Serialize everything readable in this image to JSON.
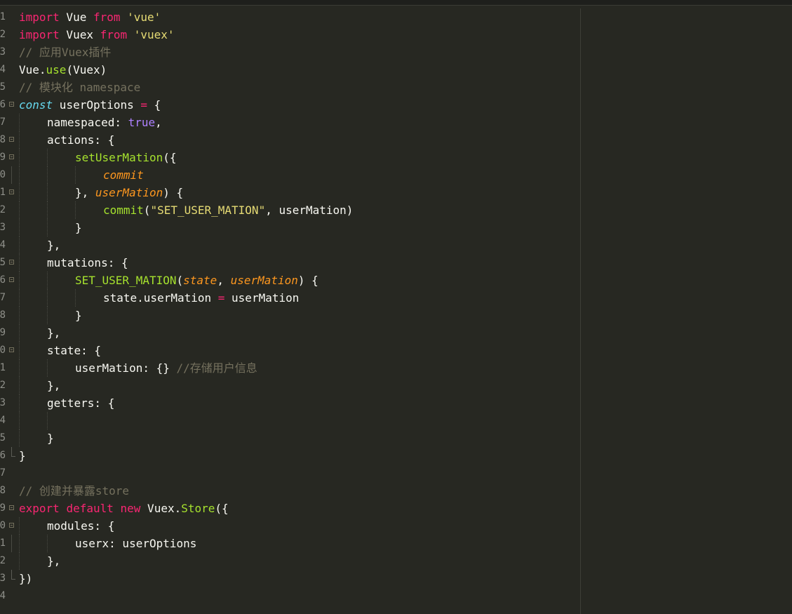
{
  "editor": {
    "theme": "monokai",
    "colors": {
      "background": "#272822",
      "keyword": "#f92672",
      "string": "#e6db74",
      "comment": "#75715e",
      "function": "#a6e22e",
      "argument": "#fd971f",
      "constant": "#ae81ff",
      "storage": "#66d9ef",
      "text": "#f8f8f2"
    },
    "line_numbers": [
      "1",
      "2",
      "3",
      "4",
      "5",
      "6",
      "7",
      "8",
      "9",
      "0",
      "1",
      "2",
      "3",
      "4",
      "5",
      "6",
      "7",
      "8",
      "9",
      "0",
      "1",
      "2",
      "3",
      "4",
      "5",
      "6",
      "7",
      "8",
      "9",
      "0",
      "1",
      "2",
      "3",
      "4"
    ],
    "code": {
      "l1": {
        "kw1": "import",
        "t1": " Vue ",
        "kw2": "from",
        "t2": " ",
        "s": "'vue'"
      },
      "l2": {
        "kw1": "import",
        "t1": " Vuex ",
        "kw2": "from",
        "t2": " ",
        "s": "'vuex'"
      },
      "l3": {
        "c": "// 应用Vuex插件"
      },
      "l4": {
        "t1": "Vue.",
        "f": "use",
        "t2": "(Vuex)"
      },
      "l5": {
        "c": "// 模块化 namespace"
      },
      "l6": {
        "d": "const",
        "t1": " userOptions ",
        "k": "=",
        "t2": " {"
      },
      "l7": {
        "t1": "namespaced: ",
        "v": "true",
        "t2": ","
      },
      "l8": {
        "t1": "actions: {"
      },
      "l9": {
        "f": "setUserMation",
        "t1": "({"
      },
      "l10": {
        "a": "commit"
      },
      "l11": {
        "t1": "}, ",
        "a": "userMation",
        "t2": ") {"
      },
      "l12": {
        "f": "commit",
        "t1": "(",
        "s": "\"SET_USER_MATION\"",
        "t2": ", userMation)"
      },
      "l13": {
        "t1": "}"
      },
      "l14": {
        "t1": "},"
      },
      "l15": {
        "t1": "mutations: {"
      },
      "l16": {
        "f": "SET_USER_MATION",
        "t1": "(",
        "a1": "state",
        "t2": ", ",
        "a2": "userMation",
        "t3": ") {"
      },
      "l17": {
        "t1": "state.userMation ",
        "k": "=",
        "t2": " userMation"
      },
      "l18": {
        "t1": "}"
      },
      "l19": {
        "t1": "},"
      },
      "l20": {
        "t1": "state: {"
      },
      "l21": {
        "t1": "userMation: {} ",
        "c": "//存储用户信息"
      },
      "l22": {
        "t1": "},"
      },
      "l23": {
        "t1": "getters: {"
      },
      "l24": {
        "t1": ""
      },
      "l25": {
        "t1": "}"
      },
      "l26": {
        "t1": "}"
      },
      "l27": {
        "t1": ""
      },
      "l28": {
        "c": "// 创建并暴露store"
      },
      "l29": {
        "kw1": "export",
        "t1": " ",
        "kw2": "default",
        "t2": " ",
        "kw3": "new",
        "t3": " Vuex.",
        "f": "Store",
        "t4": "({"
      },
      "l30": {
        "t1": "modules: {"
      },
      "l31": {
        "t1": "userx: userOptions"
      },
      "l32": {
        "t1": "},"
      },
      "l33": {
        "t1": "})"
      },
      "l34": {
        "t1": ""
      }
    }
  }
}
